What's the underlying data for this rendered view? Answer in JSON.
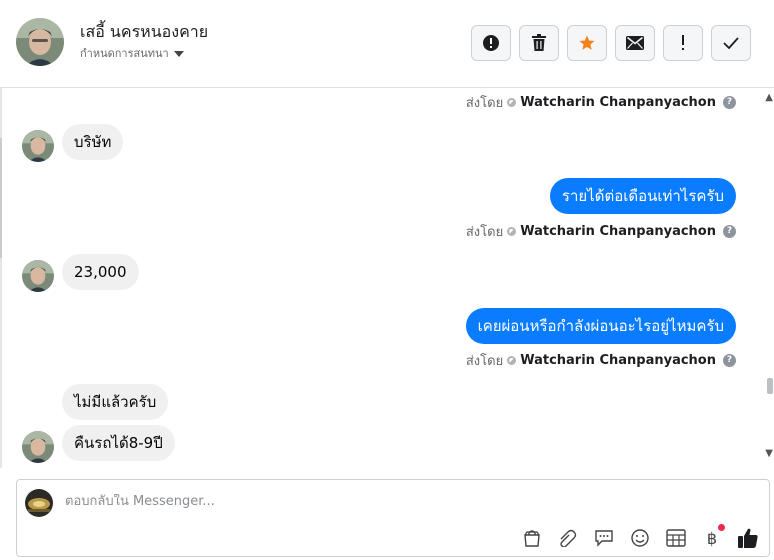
{
  "header": {
    "contact_name": "เสอี้ นครหนองคาย",
    "conversation_label": "กำหนดการสนทนา",
    "actions": [
      {
        "name": "report",
        "icon": "exclamation-circle-icon"
      },
      {
        "name": "delete",
        "icon": "trash-icon"
      },
      {
        "name": "star",
        "icon": "star-icon",
        "color": "#f5821f"
      },
      {
        "name": "mail",
        "icon": "envelope-icon"
      },
      {
        "name": "important",
        "icon": "exclamation-icon"
      },
      {
        "name": "done",
        "icon": "checkmark-icon"
      }
    ]
  },
  "thread": {
    "sent_by_prefix": "ส่งโดย",
    "sender": "Watcharin Chanpanyachon",
    "help": "?",
    "messages": [
      {
        "direction": "in",
        "text": "บริษัท"
      },
      {
        "direction": "out",
        "text": "รายได้ต่อเดือนเท่าไรครับ"
      },
      {
        "direction": "in",
        "text": "23,000"
      },
      {
        "direction": "out",
        "text": "เคยผ่อนหรือกำลังผ่อนอะไรอยู่ไหมครับ"
      },
      {
        "direction": "in",
        "text": "ไม่มีแล้วครับ"
      },
      {
        "direction": "in",
        "text": "คืนรถได้8-9ปี"
      }
    ]
  },
  "composer": {
    "placeholder": "ตอบกลับใน Messenger...",
    "tools": [
      "shopping-bag-icon",
      "paperclip-icon",
      "chat-bubble-icon",
      "emoji-icon",
      "table-icon",
      "baht-icon",
      "thumbs-up-icon"
    ],
    "baht_symbol": "฿"
  },
  "colors": {
    "outgoing_bubble": "#0a7cff",
    "incoming_bubble": "#f0f0f0",
    "star": "#f5821f"
  }
}
